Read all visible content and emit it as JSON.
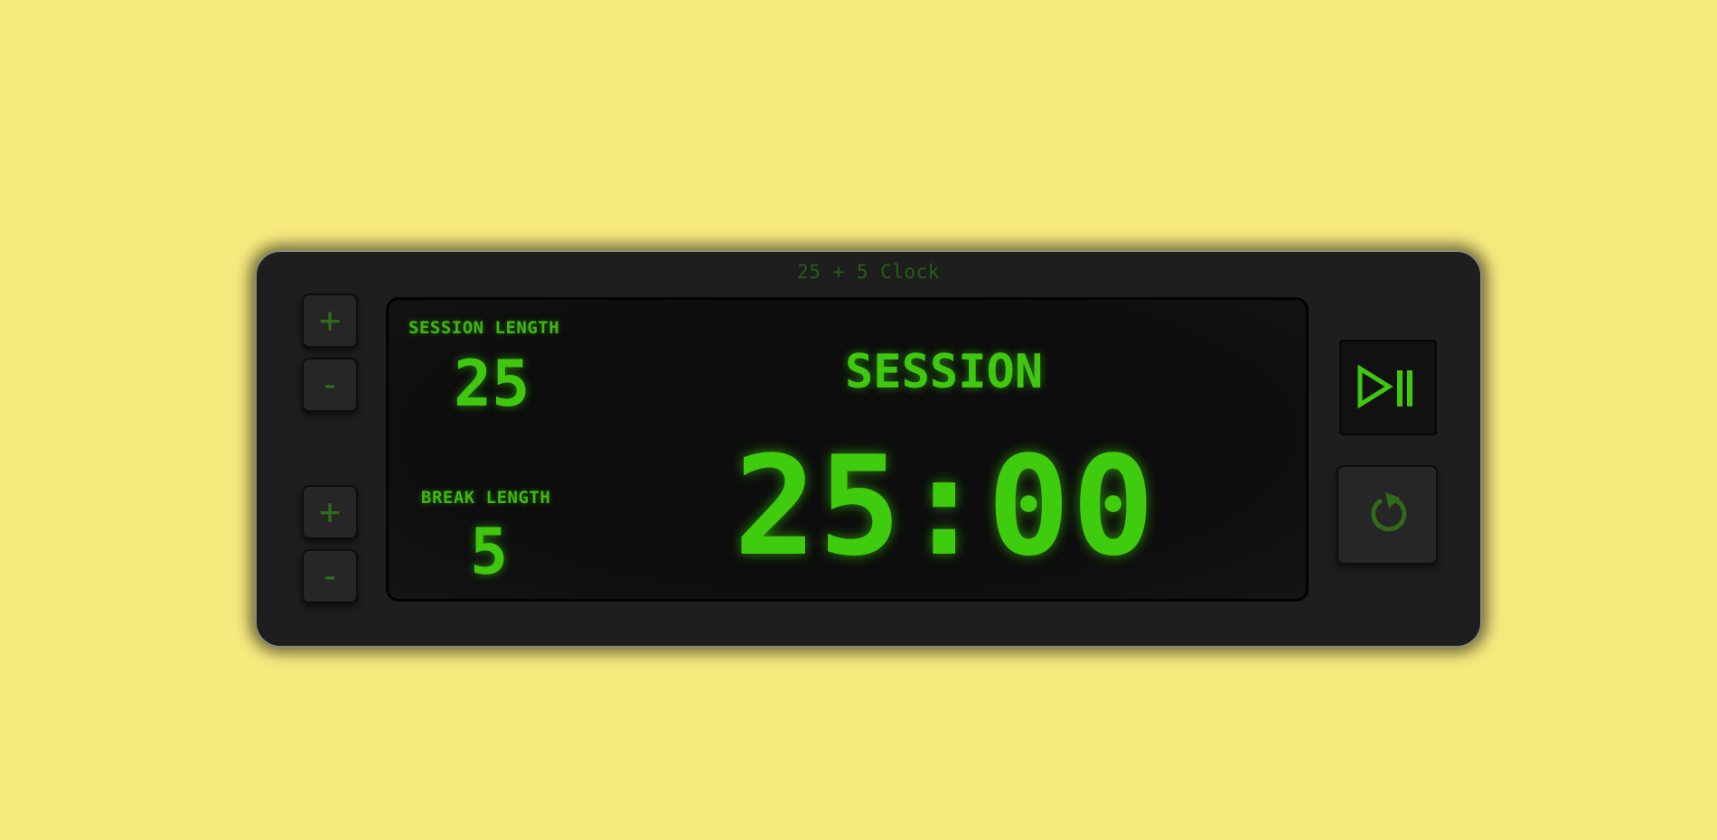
{
  "app": {
    "title": "25 + 5 Clock"
  },
  "session": {
    "label": "SESSION LENGTH",
    "value": "25",
    "increment_label": "+",
    "decrement_label": "-"
  },
  "break": {
    "label": "BREAK LENGTH",
    "value": "5",
    "increment_label": "+",
    "decrement_label": "-"
  },
  "timer": {
    "mode": "SESSION",
    "time": "25:00"
  },
  "controls": {
    "play_pause_icon": "play-pause-icon",
    "reset_icon": "reset-icon"
  },
  "colors": {
    "background": "#f6e97e",
    "device": "#1e1e1e",
    "screen": "#0d0d0d",
    "lcd_green": "#3fc80f",
    "button_green": "#2f6b1a"
  }
}
